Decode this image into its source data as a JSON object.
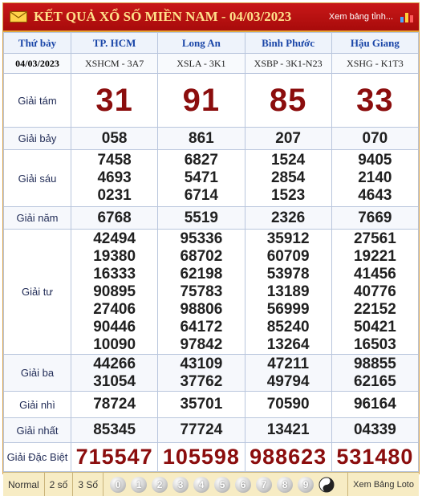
{
  "header": {
    "title": "KẾT QUẢ XỔ SỐ MIỀN NAM - 04/03/2023",
    "link": "Xem bảng tỉnh...",
    "colors": {
      "bar": "#b81212",
      "title_text": "#ffe08a",
      "prize_red": "#8b0d0d"
    }
  },
  "columns": {
    "weekday": "Thứ bảy",
    "date": "04/03/2023",
    "provinces": [
      "TP. HCM",
      "Long An",
      "Bình Phước",
      "Hậu Giang"
    ],
    "codes": [
      "XSHCM - 3A7",
      "XSLA - 3K1",
      "XSBP - 3K1-N23",
      "XSHG - K1T3"
    ]
  },
  "prizes": [
    {
      "label": "Giải tám",
      "values": [
        [
          "31"
        ],
        [
          "91"
        ],
        [
          "85"
        ],
        [
          "33"
        ]
      ]
    },
    {
      "label": "Giải bảy",
      "values": [
        [
          "058"
        ],
        [
          "861"
        ],
        [
          "207"
        ],
        [
          "070"
        ]
      ]
    },
    {
      "label": "Giải sáu",
      "values": [
        [
          "7458",
          "4693",
          "0231"
        ],
        [
          "6827",
          "5471",
          "6714"
        ],
        [
          "1524",
          "2854",
          "1523"
        ],
        [
          "9405",
          "2140",
          "4643"
        ]
      ]
    },
    {
      "label": "Giải năm",
      "values": [
        [
          "6768"
        ],
        [
          "5519"
        ],
        [
          "2326"
        ],
        [
          "7669"
        ]
      ]
    },
    {
      "label": "Giải tư",
      "values": [
        [
          "42494",
          "19380",
          "16333",
          "90895",
          "27406",
          "90446",
          "10090"
        ],
        [
          "95336",
          "68702",
          "62198",
          "75783",
          "98806",
          "64172",
          "97842"
        ],
        [
          "35912",
          "60709",
          "53978",
          "13189",
          "56999",
          "85240",
          "13264"
        ],
        [
          "27561",
          "19221",
          "41456",
          "40776",
          "22152",
          "50421",
          "16503"
        ]
      ]
    },
    {
      "label": "Giải ba",
      "values": [
        [
          "44266",
          "31054"
        ],
        [
          "43109",
          "37762"
        ],
        [
          "47211",
          "49794"
        ],
        [
          "98855",
          "62165"
        ]
      ]
    },
    {
      "label": "Giải nhì",
      "values": [
        [
          "78724"
        ],
        [
          "35701"
        ],
        [
          "70590"
        ],
        [
          "96164"
        ]
      ]
    },
    {
      "label": "Giải nhất",
      "values": [
        [
          "85345"
        ],
        [
          "77724"
        ],
        [
          "13421"
        ],
        [
          "04339"
        ]
      ]
    },
    {
      "label": "Giải Đặc Biệt",
      "values": [
        [
          "715547"
        ],
        [
          "105598"
        ],
        [
          "988623"
        ],
        [
          "531480"
        ]
      ]
    }
  ],
  "footer": {
    "modes": [
      "Normal",
      "2 số",
      "3 Số"
    ],
    "digits": [
      "0",
      "1",
      "2",
      "3",
      "4",
      "5",
      "6",
      "7",
      "8",
      "9"
    ],
    "loto_link": "Xem Bảng Loto"
  }
}
